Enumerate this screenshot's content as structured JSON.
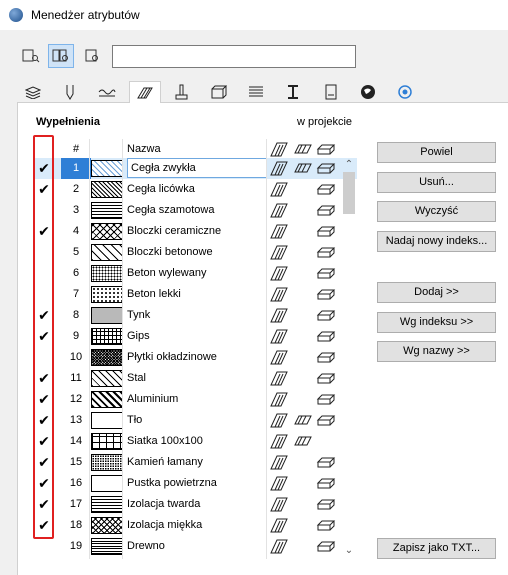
{
  "window": {
    "title": "Menedżer atrybutów"
  },
  "search": {
    "value": ""
  },
  "toolbar": {
    "buttons": [
      "view-single-icon",
      "view-double-icon",
      "view-right-icon"
    ]
  },
  "tabs": [
    "layers-icon",
    "pen-icon",
    "line-type-icon",
    "fill-icon",
    "composite-icon",
    "building-material-icon",
    "profile-icon",
    "zone-icon",
    "surface-icon",
    "location-icon",
    "settings-icon"
  ],
  "list": {
    "section_label": "Wypełnienia",
    "in_project_label": "w projekcie",
    "header": {
      "num": "#",
      "name": "Nazwa"
    },
    "rows": [
      {
        "num": "1",
        "name": "Cegła zwykła",
        "checked": true,
        "pattern": "diag-light",
        "selected": true
      },
      {
        "num": "2",
        "name": "Cegła licówka",
        "checked": true,
        "pattern": "diag-dense"
      },
      {
        "num": "3",
        "name": "Cegła szamotowa",
        "checked": false,
        "pattern": "grid-dense"
      },
      {
        "num": "4",
        "name": "Bloczki ceramiczne",
        "checked": true,
        "pattern": "diag-cross"
      },
      {
        "num": "5",
        "name": "Bloczki betonowe",
        "checked": false,
        "pattern": "diag-wide"
      },
      {
        "num": "6",
        "name": "Beton wylewany",
        "checked": false,
        "pattern": "dots"
      },
      {
        "num": "7",
        "name": "Beton lekki",
        "checked": false,
        "pattern": "dots-sparse"
      },
      {
        "num": "8",
        "name": "Tynk",
        "checked": true,
        "pattern": "dots-fine"
      },
      {
        "num": "9",
        "name": "Gips",
        "checked": true,
        "pattern": "grid"
      },
      {
        "num": "10",
        "name": "Płytki okładzinowe",
        "checked": false,
        "pattern": "cross-dense"
      },
      {
        "num": "11",
        "name": "Stal",
        "checked": true,
        "pattern": "diag"
      },
      {
        "num": "12",
        "name": "Aluminium",
        "checked": true,
        "pattern": "diag-double"
      },
      {
        "num": "13",
        "name": "Tło",
        "checked": true,
        "pattern": "empty"
      },
      {
        "num": "14",
        "name": "Siatka 100x100",
        "checked": true,
        "pattern": "grid-wide"
      },
      {
        "num": "15",
        "name": "Kamień łamany",
        "checked": true,
        "pattern": "dots-dense"
      },
      {
        "num": "16",
        "name": "Pustka powietrzna",
        "checked": true,
        "pattern": "empty"
      },
      {
        "num": "17",
        "name": "Izolacja twarda",
        "checked": true,
        "pattern": "hlines"
      },
      {
        "num": "18",
        "name": "Izolacja miękka",
        "checked": true,
        "pattern": "cross"
      },
      {
        "num": "19",
        "name": "Drewno",
        "checked": false,
        "pattern": "wood"
      }
    ]
  },
  "buttons": {
    "duplicate": "Powiel",
    "delete": "Usuń...",
    "clear": "Wyczyść",
    "new_index": "Nadaj nowy indeks...",
    "add": "Dodaj >>",
    "by_index": "Wg indeksu >>",
    "by_name": "Wg nazwy >>",
    "save_txt": "Zapisz jako TXT..."
  },
  "colors": {
    "accent": "#2f7fd6",
    "highlight_box": "#e02020"
  }
}
